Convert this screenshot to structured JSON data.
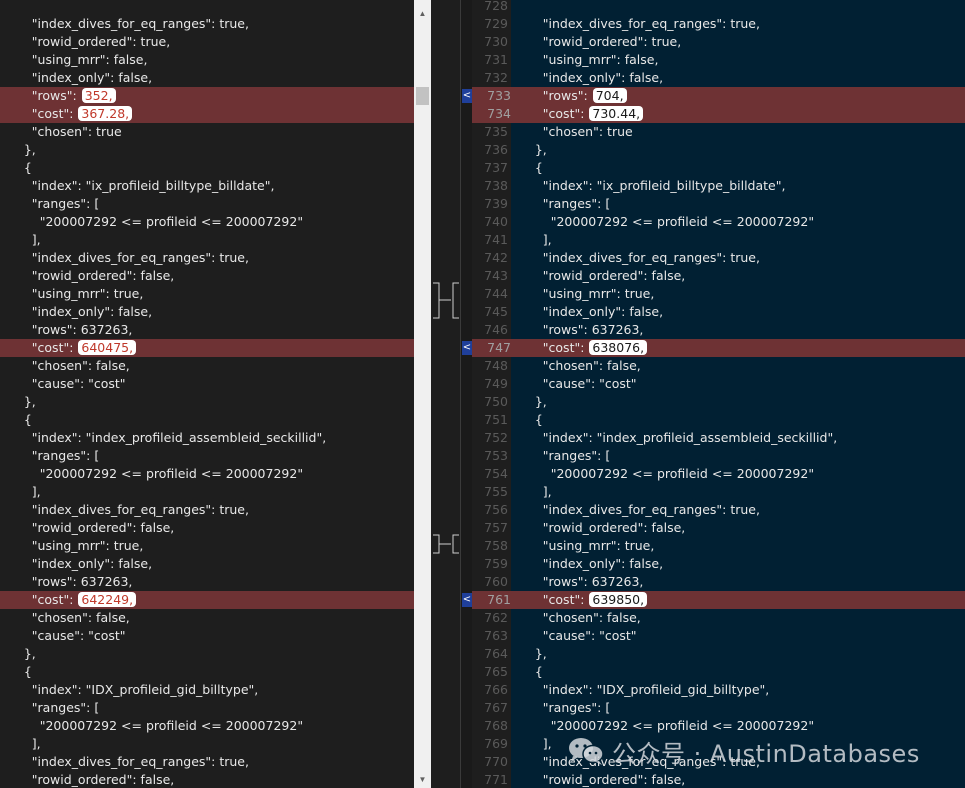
{
  "left_lines": [
    {
      "text": "        \"index_dives_for_eq_ranges\": true,"
    },
    {
      "text": "        \"rowid_ordered\": true,"
    },
    {
      "text": "        \"using_mrr\": false,"
    },
    {
      "text": "        \"index_only\": false,"
    },
    {
      "text": "        \"rows\": ",
      "hl": "352,",
      "diff": true
    },
    {
      "text": "        \"cost\": ",
      "hl": "367.28,",
      "diff": true
    },
    {
      "text": "        \"chosen\": true"
    },
    {
      "text": "      },"
    },
    {
      "text": "      {"
    },
    {
      "text": "        \"index\": \"ix_profileid_billtype_billdate\","
    },
    {
      "text": "        \"ranges\": ["
    },
    {
      "text": "          \"200007292 <= profileid <= 200007292\""
    },
    {
      "text": "        ],"
    },
    {
      "text": "        \"index_dives_for_eq_ranges\": true,"
    },
    {
      "text": "        \"rowid_ordered\": false,"
    },
    {
      "text": "        \"using_mrr\": true,"
    },
    {
      "text": "        \"index_only\": false,"
    },
    {
      "text": "        \"rows\": 637263,"
    },
    {
      "text": "        \"cost\": ",
      "hl": "640475,",
      "diff": true
    },
    {
      "text": "        \"chosen\": false,"
    },
    {
      "text": "        \"cause\": \"cost\""
    },
    {
      "text": "      },"
    },
    {
      "text": "      {"
    },
    {
      "text": "        \"index\": \"index_profileid_assembleid_seckillid\","
    },
    {
      "text": "        \"ranges\": ["
    },
    {
      "text": "          \"200007292 <= profileid <= 200007292\""
    },
    {
      "text": "        ],"
    },
    {
      "text": "        \"index_dives_for_eq_ranges\": true,"
    },
    {
      "text": "        \"rowid_ordered\": false,"
    },
    {
      "text": "        \"using_mrr\": true,"
    },
    {
      "text": "        \"index_only\": false,"
    },
    {
      "text": "        \"rows\": 637263,"
    },
    {
      "text": "        \"cost\": ",
      "hl": "642249,",
      "diff": true
    },
    {
      "text": "        \"chosen\": false,"
    },
    {
      "text": "        \"cause\": \"cost\""
    },
    {
      "text": "      },"
    },
    {
      "text": "      {"
    },
    {
      "text": "        \"index\": \"IDX_profileid_gid_billtype\","
    },
    {
      "text": "        \"ranges\": ["
    },
    {
      "text": "          \"200007292 <= profileid <= 200007292\""
    },
    {
      "text": "        ],"
    },
    {
      "text": "        \"index_dives_for_eq_ranges\": true,"
    },
    {
      "text": "        \"rowid_ordered\": false,"
    }
  ],
  "right_lines": [
    {
      "num": "728",
      "text": ""
    },
    {
      "num": "729",
      "text": "        \"index_dives_for_eq_ranges\": true,"
    },
    {
      "num": "730",
      "text": "        \"rowid_ordered\": true,"
    },
    {
      "num": "731",
      "text": "        \"using_mrr\": false,"
    },
    {
      "num": "732",
      "text": "        \"index_only\": false,"
    },
    {
      "num": "733",
      "text": "        \"rows\": ",
      "hl": "704,",
      "diff": true,
      "marker": true
    },
    {
      "num": "734",
      "text": "        \"cost\": ",
      "hl": "730.44,",
      "diff": true
    },
    {
      "num": "735",
      "text": "        \"chosen\": true"
    },
    {
      "num": "736",
      "text": "      },"
    },
    {
      "num": "737",
      "text": "      {"
    },
    {
      "num": "738",
      "text": "        \"index\": \"ix_profileid_billtype_billdate\","
    },
    {
      "num": "739",
      "text": "        \"ranges\": ["
    },
    {
      "num": "740",
      "text": "          \"200007292 <= profileid <= 200007292\""
    },
    {
      "num": "741",
      "text": "        ],"
    },
    {
      "num": "742",
      "text": "        \"index_dives_for_eq_ranges\": true,"
    },
    {
      "num": "743",
      "text": "        \"rowid_ordered\": false,"
    },
    {
      "num": "744",
      "text": "        \"using_mrr\": true,"
    },
    {
      "num": "745",
      "text": "        \"index_only\": false,"
    },
    {
      "num": "746",
      "text": "        \"rows\": 637263,"
    },
    {
      "num": "747",
      "text": "        \"cost\": ",
      "hl": "638076,",
      "diff": true,
      "marker": true
    },
    {
      "num": "748",
      "text": "        \"chosen\": false,"
    },
    {
      "num": "749",
      "text": "        \"cause\": \"cost\""
    },
    {
      "num": "750",
      "text": "      },"
    },
    {
      "num": "751",
      "text": "      {"
    },
    {
      "num": "752",
      "text": "        \"index\": \"index_profileid_assembleid_seckillid\","
    },
    {
      "num": "753",
      "text": "        \"ranges\": ["
    },
    {
      "num": "754",
      "text": "          \"200007292 <= profileid <= 200007292\""
    },
    {
      "num": "755",
      "text": "        ],"
    },
    {
      "num": "756",
      "text": "        \"index_dives_for_eq_ranges\": true,"
    },
    {
      "num": "757",
      "text": "        \"rowid_ordered\": false,"
    },
    {
      "num": "758",
      "text": "        \"using_mrr\": true,"
    },
    {
      "num": "759",
      "text": "        \"index_only\": false,"
    },
    {
      "num": "760",
      "text": "        \"rows\": 637263,"
    },
    {
      "num": "761",
      "text": "        \"cost\": ",
      "hl": "639850,",
      "diff": true,
      "marker": true
    },
    {
      "num": "762",
      "text": "        \"chosen\": false,"
    },
    {
      "num": "763",
      "text": "        \"cause\": \"cost\""
    },
    {
      "num": "764",
      "text": "      },"
    },
    {
      "num": "765",
      "text": "      {"
    },
    {
      "num": "766",
      "text": "        \"index\": \"IDX_profileid_gid_billtype\","
    },
    {
      "num": "767",
      "text": "        \"ranges\": ["
    },
    {
      "num": "768",
      "text": "          \"200007292 <= profileid <= 200007292\""
    },
    {
      "num": "769",
      "text": "        ],"
    },
    {
      "num": "770",
      "text": "        \"index_dives_for_eq_ranges\": true,"
    },
    {
      "num": "771",
      "text": "        \"rowid_ordered\": false,"
    }
  ],
  "watermark": {
    "text": "公众号 · AustinDatabases",
    "icon": "wechat-icon"
  },
  "colors": {
    "left_bg": "#1e1e1e",
    "right_bg": "#012033",
    "diff_bg": "#6e3234",
    "marker": "#1f3f9a"
  },
  "icons": {
    "scroll_up": "scroll-up-arrow-icon",
    "scroll_down": "scroll-down-arrow-icon",
    "copy_left": "chevron-left-icon"
  }
}
